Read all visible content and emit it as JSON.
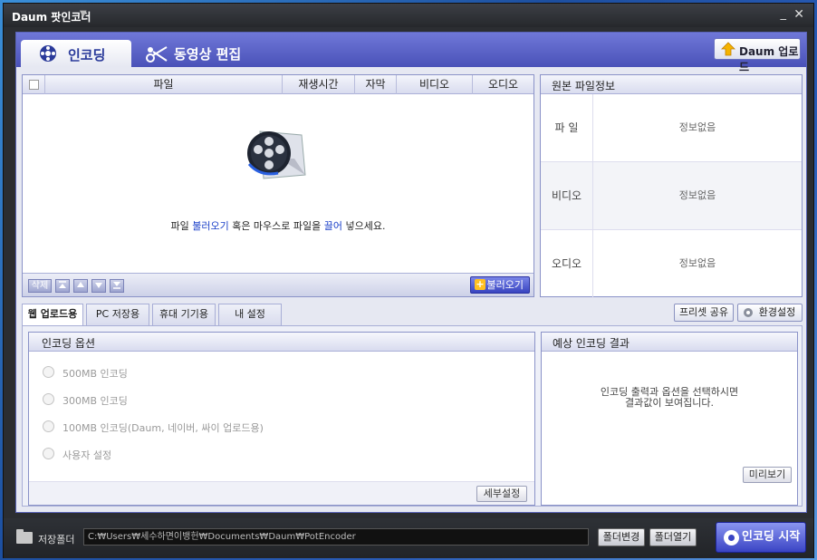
{
  "window": {
    "title": "Daum 팟인코더",
    "dropdown_glyph": "▼",
    "minimize_glyph": "_",
    "close_glyph": "✕"
  },
  "top_tabs": [
    {
      "label": "인코딩",
      "active": true
    },
    {
      "label": "동영상 편집",
      "active": false
    }
  ],
  "upload_button": {
    "label": "Daum 업로드"
  },
  "file_list": {
    "columns": [
      "파일",
      "재생시간",
      "자막",
      "비디오",
      "오디오"
    ],
    "empty_prefix": "파일 ",
    "empty_link1": "불러오기",
    "empty_mid": " 혹은 마우스로 파일을 ",
    "empty_link2": "끌어",
    "empty_suffix": " 넣으세요.",
    "delete_label": "삭제",
    "load_label": "불러오기",
    "load_plus": "+"
  },
  "source_info": {
    "title": "원본 파일정보",
    "rows": [
      {
        "key": "파 일",
        "value": "정보없음"
      },
      {
        "key": "비디오",
        "value": "정보없음"
      },
      {
        "key": "오디오",
        "value": "정보없음"
      }
    ]
  },
  "preset_tabs": [
    "웹 업로드용",
    "PC 저장용",
    "휴대 기기용",
    "내 설정"
  ],
  "preset_share_label": "프리셋 공유",
  "settings_label": "환경설정",
  "encoding_options": {
    "title": "인코딩 옵션",
    "options": [
      "500MB 인코딩",
      "300MB 인코딩",
      "100MB 인코딩(Daum, 네이버, 싸이 업로드용)",
      "사용자 설정"
    ],
    "detail_button": "세부설정"
  },
  "expected_result": {
    "title": "예상 인코딩 결과",
    "message_line1": "인코딩 출력과 옵션을 선택하시면",
    "message_line2": "결과값이 보여집니다.",
    "preview_button": "미리보기"
  },
  "save_folder": {
    "label": "저장폴더",
    "path": "C:₩Users₩세수하면이뱅헌₩Documents₩Daum₩PotEncoder",
    "change_button": "폴더변경",
    "open_button": "폴더열기"
  },
  "start_button": {
    "label": "인코딩 시작"
  },
  "colors": {
    "accent": "#4a52b8",
    "link": "#1a3fc8"
  }
}
